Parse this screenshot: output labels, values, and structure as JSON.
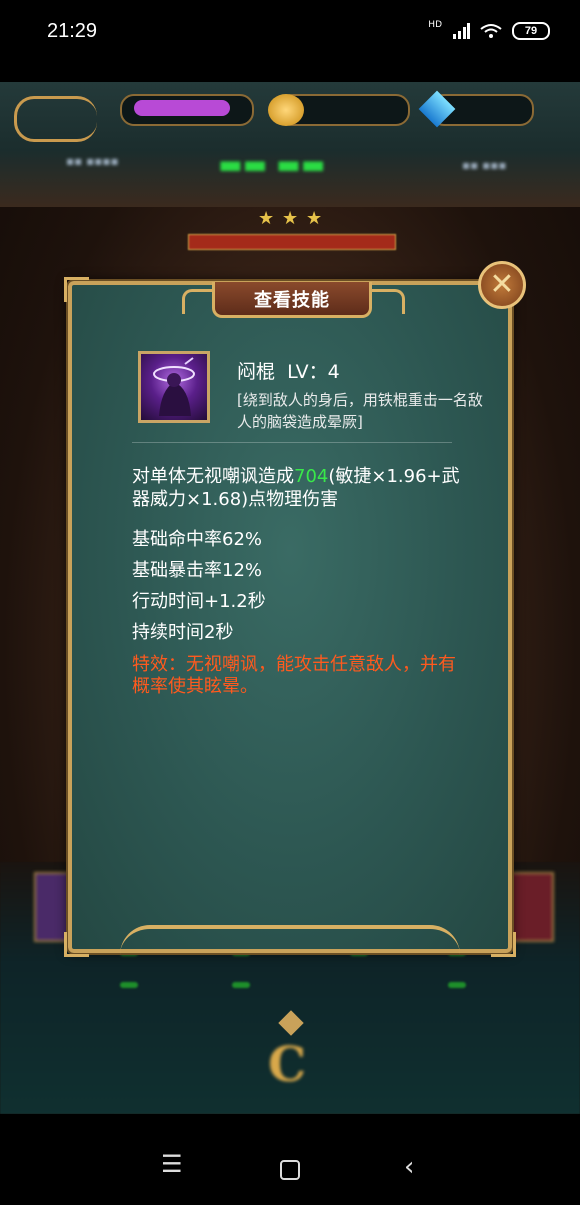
{
  "status_bar": {
    "time": "21:29",
    "battery": "79",
    "network": "HD"
  },
  "dialog": {
    "title": "查看技能",
    "skill": {
      "name": "闷棍  LV：4",
      "description": "[绕到敌人的身后，用铁棍重击一名敌人的脑袋造成晕厥]"
    },
    "effect": {
      "prefix": "对单体无视嘲讽造成",
      "value": "704",
      "suffix": "(敏捷×1.96+武器威力×1.68)点物理伤害"
    },
    "stats": [
      "基础命中率62%",
      "基础暴击率12%",
      "行动时间+1.2秒",
      "持续时间2秒"
    ],
    "special": "特效：无视嘲讽，能攻击任意敌人，并有概率使其眩晕。"
  },
  "colors": {
    "panel": "#2d5752",
    "frame_gold": "#c9a25a",
    "highlight_green": "#39e84a",
    "special_orange": "#ff5a1e"
  }
}
